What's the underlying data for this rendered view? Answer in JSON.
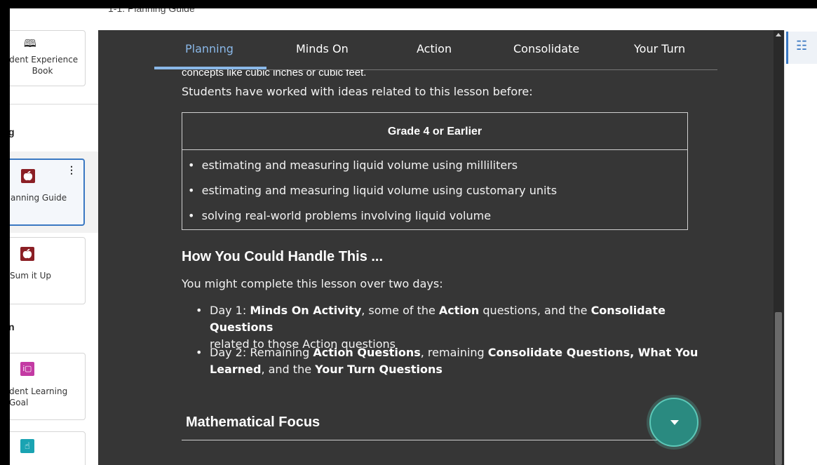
{
  "breadcrumb": "1-1: Planning Guide",
  "sidebar": {
    "top_card_label": "ident Experience Book",
    "section_g": "g",
    "section_n": "n",
    "items": [
      {
        "label": "anning Guide",
        "icon": "apple-icon",
        "selected": true
      },
      {
        "label": "Sum it Up",
        "icon": "apple-icon",
        "selected": false
      },
      {
        "label": "dent Learning Goal",
        "icon": "learning-goal-icon",
        "selected": false
      },
      {
        "label": "",
        "icon": "hand-pointer-icon",
        "selected": false
      }
    ],
    "more_glyph": "⋮"
  },
  "tabs": [
    "Planning",
    "Minds On",
    "Action",
    "Consolidate",
    "Your Turn"
  ],
  "active_tab": "Planning",
  "content": {
    "cut_line": "concepts like cubic inches or cubic feet.",
    "intro": "Students have worked with ideas related to this lesson before:",
    "table_heading": "Grade 4 or Earlier",
    "table_items": [
      "estimating and measuring liquid volume using milliliters",
      "estimating and measuring liquid volume using customary units",
      "solving real-world problems involving liquid volume"
    ],
    "handle_heading": "How You Could Handle This ...",
    "handle_intro": "You might complete this lesson over two days:",
    "day1": {
      "p1": "Day 1: ",
      "b1": "Minds On Activity",
      "p2": ", some of the ",
      "b2": "Action",
      "p3": " questions, and the ",
      "b3": "Consolidate Questions",
      "p4": "related to those Action questions"
    },
    "day2": {
      "p1": "Day 2: Remaining ",
      "b1": "Action Questions",
      "p2": ", remaining ",
      "b2": "Consolidate Questions, What You",
      "b3": "Learned",
      "p3": ", and the ",
      "b4": "Your Turn Questions"
    },
    "focus_heading": "Mathematical Focus"
  },
  "colors": {
    "panel": "#363636",
    "accent": "#8ab8e8",
    "fab": "#2a8a80",
    "brand_red": "#8b1f25"
  }
}
